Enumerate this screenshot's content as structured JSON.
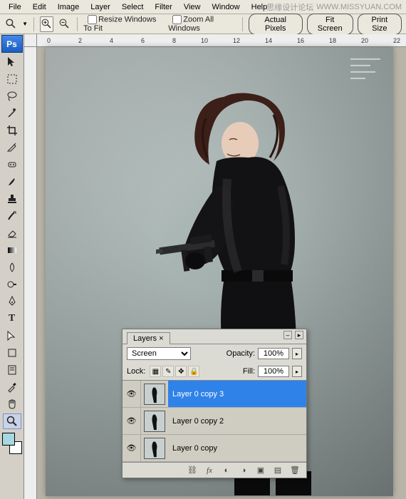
{
  "watermark": {
    "text1": "思缘设计论坛",
    "text2": "WWW.MISSYUAN.COM"
  },
  "menu": {
    "file": "File",
    "edit": "Edit",
    "image": "Image",
    "layer": "Layer",
    "select": "Select",
    "filter": "Filter",
    "view": "View",
    "window": "Window",
    "help": "Help"
  },
  "options": {
    "resize_label": "Resize Windows To Fit",
    "zoom_all_label": "Zoom All Windows",
    "actual_pixels": "Actual Pixels",
    "fit_screen": "Fit Screen",
    "print_size": "Print Size"
  },
  "ruler": {
    "ticks": [
      "0",
      "2",
      "4",
      "6",
      "8",
      "10",
      "12",
      "14",
      "16",
      "18",
      "20",
      "22"
    ]
  },
  "layers_panel": {
    "tab": "Layers",
    "blend_mode": "Screen",
    "opacity_label": "Opacity:",
    "opacity_value": "100%",
    "lock_label": "Lock:",
    "fill_label": "Fill:",
    "fill_value": "100%",
    "layers": [
      {
        "name": "Layer 0 copy 3",
        "visible": true,
        "active": true
      },
      {
        "name": "Layer 0 copy 2",
        "visible": true,
        "active": false
      },
      {
        "name": "Layer 0 copy",
        "visible": true,
        "active": false
      }
    ]
  },
  "colors": {
    "fg": "#a5d8e0",
    "bg": "#ffffff",
    "accent": "#2f82e8"
  }
}
